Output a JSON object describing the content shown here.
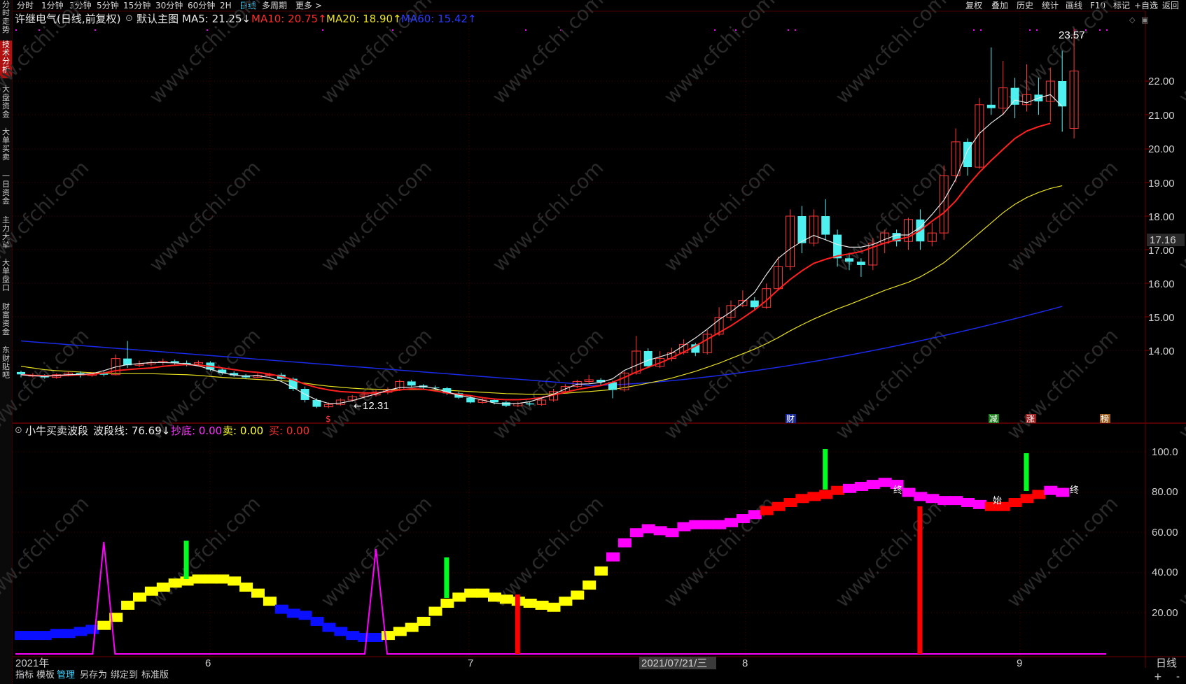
{
  "topbar": {
    "periods": [
      "分时",
      "1分钟",
      "3分钟",
      "5分钟",
      "15分钟",
      "30分钟",
      "60分钟",
      "2H",
      "日线",
      "多周期",
      "更多 >"
    ],
    "active_period": "日线",
    "tools": [
      "复权",
      "叠加",
      "历史",
      "统计",
      "画线",
      "F10",
      "标记",
      "+自选",
      "返回"
    ]
  },
  "sidebar": {
    "items": [
      {
        "label": "分时走势",
        "active": false
      },
      {
        "label": "技术分析",
        "active": true
      },
      {
        "label": "大盘资金",
        "active": false
      },
      {
        "label": "大单买卖",
        "active": false
      },
      {
        "label": "一日资金",
        "active": false
      },
      {
        "label": "主力大单",
        "active": false
      },
      {
        "label": "大单盘口",
        "active": false
      },
      {
        "label": "财富资金",
        "active": false
      },
      {
        "label": "东财贴吧",
        "active": false
      }
    ]
  },
  "main_header": {
    "stock": "许继电气(日线,前复权)",
    "template": "默认主图",
    "ma5": "MA5: 21.25↓",
    "ma10": "MA10: 20.75↑",
    "ma20": "MA20: 18.90↑",
    "ma60": "MA60: 15.42↑"
  },
  "indicator_header": {
    "name": "小牛买卖波段",
    "wave": "波段线: 76.69↓",
    "bottom": "抄底: 0.00",
    "sell": "卖: 0.00",
    "buy": "买: 0.00"
  },
  "colors": {
    "up": "#ff3a3a",
    "down": "#4ff0f0",
    "ma5": "#e8e8e8",
    "ma10": "#ff2020",
    "ma20": "#e8e020",
    "ma60": "#1a2ae8",
    "grid": "#4a0000",
    "yellow": "#ffff00",
    "blue": "#0a10ff",
    "magenta": "#ff00ff",
    "red": "#ff0000",
    "green": "#00ff20"
  },
  "price_axis": {
    "ticks": [
      "22.00",
      "21.00",
      "20.00",
      "19.00",
      "18.00",
      "17.00",
      "16.00",
      "15.00",
      "14.00"
    ],
    "current": "17.16"
  },
  "indicator_axis": {
    "ticks": [
      "100.0",
      "80.00",
      "60.00",
      "40.00",
      "20.00"
    ]
  },
  "time_axis": {
    "labels": [
      "2021年",
      "6",
      "7",
      "8",
      "9"
    ],
    "cursor": "2021/07/21/三",
    "period": "日线"
  },
  "annotations": {
    "high": "23.57",
    "low": "12.31",
    "markers": [
      "$",
      "财",
      "减",
      "涨",
      "榜"
    ],
    "wave_labels": [
      "终",
      "始"
    ]
  },
  "bottombar": {
    "items": [
      "指标",
      "模板",
      "管理",
      "另存为",
      "绑定到",
      "标准版"
    ],
    "active": "管理"
  },
  "watermark": "www.cfchi.com",
  "chart_data": {
    "type": "candlestick",
    "price_range": [
      12.0,
      23.9
    ],
    "candles": [
      [
        13.38,
        13.31,
        13.42,
        13.22
      ],
      [
        13.27,
        13.28,
        13.35,
        13.22
      ],
      [
        13.28,
        13.22,
        13.31,
        13.18
      ],
      [
        13.22,
        13.3,
        13.34,
        13.18
      ],
      [
        13.3,
        13.35,
        13.4,
        13.25
      ],
      [
        13.35,
        13.28,
        13.4,
        13.22
      ],
      [
        13.28,
        13.33,
        13.38,
        13.24
      ],
      [
        13.33,
        13.3,
        13.4,
        13.25
      ],
      [
        13.3,
        13.78,
        13.9,
        13.28
      ],
      [
        13.78,
        13.58,
        14.3,
        13.5
      ],
      [
        13.58,
        13.62,
        13.72,
        13.52
      ],
      [
        13.62,
        13.66,
        13.75,
        13.55
      ],
      [
        13.66,
        13.7,
        13.78,
        13.58
      ],
      [
        13.7,
        13.65,
        13.75,
        13.58
      ],
      [
        13.65,
        13.62,
        13.72,
        13.55
      ],
      [
        13.62,
        13.66,
        13.72,
        13.58
      ],
      [
        13.66,
        13.45,
        13.7,
        13.4
      ],
      [
        13.45,
        13.35,
        13.5,
        13.3
      ],
      [
        13.35,
        13.28,
        13.4,
        13.24
      ],
      [
        13.28,
        13.22,
        13.32,
        13.18
      ],
      [
        13.22,
        13.28,
        13.34,
        13.2
      ],
      [
        13.28,
        13.3,
        13.36,
        13.24
      ],
      [
        13.3,
        13.18,
        13.36,
        13.15
      ],
      [
        13.18,
        12.88,
        13.22,
        12.82
      ],
      [
        12.88,
        12.55,
        12.95,
        12.48
      ],
      [
        12.55,
        12.35,
        12.6,
        12.31
      ],
      [
        12.35,
        12.42,
        12.48,
        12.31
      ],
      [
        12.42,
        12.55,
        12.6,
        12.38
      ],
      [
        12.55,
        12.65,
        12.7,
        12.5
      ],
      [
        12.65,
        12.7,
        12.78,
        12.6
      ],
      [
        12.7,
        12.78,
        12.84,
        12.65
      ],
      [
        12.78,
        12.85,
        12.92,
        12.72
      ],
      [
        12.85,
        13.1,
        13.15,
        12.82
      ],
      [
        13.1,
        12.98,
        13.15,
        12.92
      ],
      [
        12.98,
        12.92,
        13.02,
        12.88
      ],
      [
        12.92,
        12.9,
        12.98,
        12.84
      ],
      [
        12.9,
        12.75,
        12.94,
        12.7
      ],
      [
        12.75,
        12.62,
        12.8,
        12.58
      ],
      [
        12.62,
        12.48,
        12.68,
        12.45
      ],
      [
        12.48,
        12.55,
        12.6,
        12.44
      ],
      [
        12.55,
        12.48,
        12.6,
        12.42
      ],
      [
        12.48,
        12.38,
        12.52,
        12.34
      ],
      [
        12.38,
        12.45,
        12.5,
        12.34
      ],
      [
        12.45,
        12.42,
        12.5,
        12.38
      ],
      [
        12.42,
        12.55,
        12.6,
        12.38
      ],
      [
        12.55,
        12.8,
        12.88,
        12.5
      ],
      [
        12.8,
        12.95,
        13.02,
        12.75
      ],
      [
        12.95,
        13.1,
        13.15,
        12.9
      ],
      [
        13.1,
        13.15,
        13.3,
        13.05
      ],
      [
        13.15,
        13.08,
        13.2,
        13.0
      ],
      [
        13.08,
        12.85,
        13.12,
        12.6
      ],
      [
        12.85,
        13.35,
        13.4,
        12.8
      ],
      [
        13.35,
        14.0,
        14.45,
        13.3
      ],
      [
        14.0,
        13.55,
        14.08,
        13.5
      ],
      [
        13.55,
        13.78,
        14.0,
        13.5
      ],
      [
        13.78,
        13.95,
        14.1,
        13.7
      ],
      [
        13.95,
        14.2,
        14.35,
        13.9
      ],
      [
        14.2,
        13.95,
        14.25,
        13.85
      ],
      [
        13.95,
        14.5,
        14.62,
        13.9
      ],
      [
        14.5,
        15.0,
        15.3,
        14.45
      ],
      [
        15.0,
        15.35,
        15.5,
        14.9
      ],
      [
        15.35,
        15.5,
        15.8,
        15.3
      ],
      [
        15.5,
        15.3,
        15.6,
        15.2
      ],
      [
        15.3,
        15.85,
        16.0,
        15.25
      ],
      [
        15.85,
        16.5,
        16.8,
        15.8
      ],
      [
        16.5,
        18.0,
        18.2,
        16.4
      ],
      [
        18.0,
        17.2,
        18.3,
        16.9
      ],
      [
        17.2,
        18.0,
        18.2,
        17.1
      ],
      [
        18.0,
        17.45,
        18.5,
        17.3
      ],
      [
        17.45,
        16.75,
        17.6,
        16.5
      ],
      [
        16.75,
        16.65,
        16.9,
        16.4
      ],
      [
        16.65,
        16.55,
        16.75,
        16.2
      ],
      [
        16.55,
        17.2,
        17.35,
        16.4
      ],
      [
        17.2,
        17.5,
        17.6,
        16.9
      ],
      [
        17.5,
        17.25,
        17.6,
        17.1
      ],
      [
        17.25,
        17.9,
        17.95,
        17.0
      ],
      [
        17.9,
        17.25,
        18.2,
        17.0
      ],
      [
        17.25,
        17.5,
        17.8,
        17.1
      ],
      [
        17.5,
        19.2,
        19.5,
        17.3
      ],
      [
        19.2,
        20.2,
        20.6,
        19.0
      ],
      [
        20.2,
        19.45,
        20.3,
        19.2
      ],
      [
        19.45,
        21.3,
        21.5,
        19.4
      ],
      [
        21.3,
        21.2,
        23.0,
        21.0
      ],
      [
        21.2,
        21.8,
        22.6,
        21.0
      ],
      [
        21.8,
        21.3,
        22.1,
        20.9
      ],
      [
        21.3,
        21.6,
        22.5,
        21.1
      ],
      [
        21.6,
        21.4,
        22.1,
        21.0
      ],
      [
        21.4,
        22.0,
        22.4,
        20.8
      ],
      [
        22.0,
        21.25,
        22.9,
        20.5
      ],
      [
        20.6,
        22.3,
        23.57,
        20.3
      ]
    ],
    "ma5": [
      13.3,
      13.27,
      13.25,
      13.28,
      13.3,
      13.31,
      13.33,
      13.42,
      13.53,
      13.6,
      13.63,
      13.66,
      13.66,
      13.65,
      13.62,
      13.56,
      13.46,
      13.36,
      13.29,
      13.26,
      13.27,
      13.22,
      13.1,
      12.92,
      12.72,
      12.55,
      12.45,
      12.46,
      12.53,
      12.63,
      12.73,
      12.84,
      12.92,
      12.93,
      12.96,
      12.89,
      12.79,
      12.69,
      12.63,
      12.55,
      12.46,
      12.44,
      12.45,
      12.5,
      12.61,
      12.72,
      12.88,
      13.02,
      13.03,
      13.07,
      13.18,
      13.43,
      13.58,
      13.73,
      13.83,
      13.94,
      14.16,
      14.39,
      14.65,
      14.93,
      15.16,
      15.43,
      15.74,
      16.27,
      16.75,
      17.03,
      17.25,
      17.43,
      17.3,
      17.16,
      17.08,
      17.08,
      17.16,
      17.31,
      17.44,
      17.44,
      17.67,
      18.05,
      18.47,
      19.09,
      19.95,
      20.45,
      20.76,
      21.02,
      21.44,
      21.36,
      21.5,
      21.6,
      21.25
    ],
    "ma10": [
      13.3,
      13.28,
      13.27,
      13.27,
      13.28,
      13.3,
      13.31,
      13.35,
      13.42,
      13.45,
      13.48,
      13.5,
      13.55,
      13.58,
      13.6,
      13.58,
      13.55,
      13.5,
      13.45,
      13.4,
      13.37,
      13.32,
      13.25,
      13.15,
      13.02,
      12.92,
      12.85,
      12.8,
      12.78,
      12.76,
      12.76,
      12.8,
      12.85,
      12.88,
      12.87,
      12.82,
      12.76,
      12.72,
      12.68,
      12.62,
      12.58,
      12.56,
      12.56,
      12.58,
      12.62,
      12.7,
      12.78,
      12.86,
      12.92,
      12.98,
      13.08,
      13.22,
      13.38,
      13.52,
      13.65,
      13.8,
      13.97,
      14.15,
      14.35,
      14.55,
      14.75,
      14.98,
      15.22,
      15.5,
      15.82,
      16.12,
      16.38,
      16.6,
      16.72,
      16.82,
      16.88,
      16.95,
      17.08,
      17.2,
      17.3,
      17.38,
      17.58,
      17.85,
      18.1,
      18.45,
      18.9,
      19.3,
      19.65,
      19.98,
      20.3,
      20.52,
      20.65,
      20.75
    ]
  }
}
